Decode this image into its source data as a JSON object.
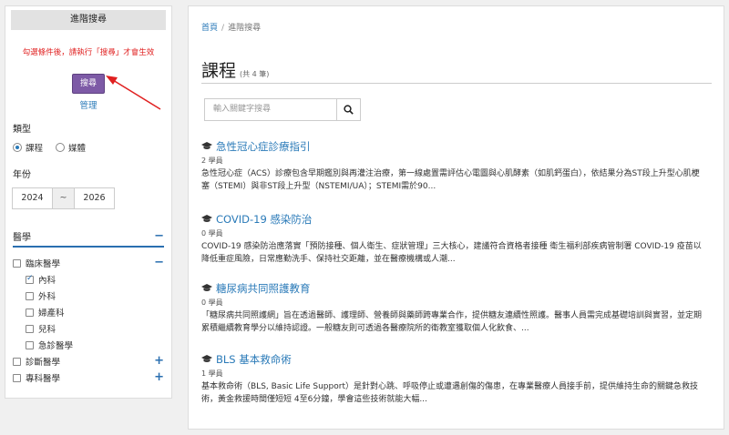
{
  "sidebar": {
    "header": "進階搜尋",
    "warning": "勾選條件後，請執行「搜尋」才會生效",
    "search_label": "搜尋",
    "manage_label": "管理",
    "type_title": "類型",
    "type_options": [
      {
        "label": "課程",
        "checked": true
      },
      {
        "label": "媒體",
        "checked": false
      }
    ],
    "year_title": "年份",
    "year_from": "2024",
    "year_sep": "~",
    "year_to": "2026",
    "medicine": {
      "title": "醫學",
      "toggle": "−",
      "groups": [
        {
          "label": "臨床醫學",
          "toggle": "−",
          "checked": false,
          "children": [
            {
              "label": "內科",
              "checked": true
            },
            {
              "label": "外科",
              "checked": false
            },
            {
              "label": "婦產科",
              "checked": false
            },
            {
              "label": "兒科",
              "checked": false
            },
            {
              "label": "急診醫學",
              "checked": false
            }
          ]
        },
        {
          "label": "診斷醫學",
          "toggle": "+",
          "checked": false
        },
        {
          "label": "專科醫學",
          "toggle": "+",
          "checked": false
        }
      ]
    }
  },
  "main": {
    "breadcrumb_home": "首頁",
    "breadcrumb_sep": "/",
    "breadcrumb_current": "進階搜尋",
    "title": "課程",
    "count": "(共 4 筆)",
    "search_placeholder": "輸入關鍵字搜尋",
    "courses": [
      {
        "title": "急性冠心症診療指引",
        "meta": "2 學員",
        "desc": "急性冠心症（ACS）診療包含早期鑑別與再灌注治療，第一線處置需評估心電圖與心肌酵素（如肌鈣蛋白），依結果分為ST段上升型心肌梗塞（STEMI）與非ST段上升型（NSTEMI/UA）；STEMI需於90..."
      },
      {
        "title": "COVID-19 感染防治",
        "meta": "0 學員",
        "desc": "COVID-19 感染防治應落實「預防接種、個人衛生、症狀管理」三大核心，建議符合資格者接種 衛生福利部疾病管制署 COVID-19 疫苗以降低重症風險，日常應勤洗手、保持社交距離，並在醫療機構或人潮..."
      },
      {
        "title": "糖尿病共同照護教育",
        "meta": "0 學員",
        "desc": "「糖尿病共同照護網」旨在透過醫師、護理師、營養師與藥師跨專業合作，提供糖友連續性照護。醫事人員需完成基礎培訓與實習，並定期累積繼續教育學分以維持認證。一般糖友則可透過各醫療院所的衛教室獲取個人化飲食、..."
      },
      {
        "title": "BLS 基本救命術",
        "meta": "1 學員",
        "desc": "基本救命術（BLS, Basic Life Support）是針對心跳、呼吸停止或遭遇創傷的傷患，在專業醫療人員接手前，提供維持生命的關鍵急救技術，黃金救援時間僅短短 4至6分鐘，學會這些技術就能大幅..."
      }
    ]
  },
  "colors": {
    "accent": "#7d5aa6",
    "link": "#2a7ab8",
    "warning": "#e02020",
    "arrow": "#e02020"
  },
  "icons": {
    "course": "graduation-cap-icon",
    "search": "magnifier-icon",
    "annotation": "red-arrow-icon"
  }
}
